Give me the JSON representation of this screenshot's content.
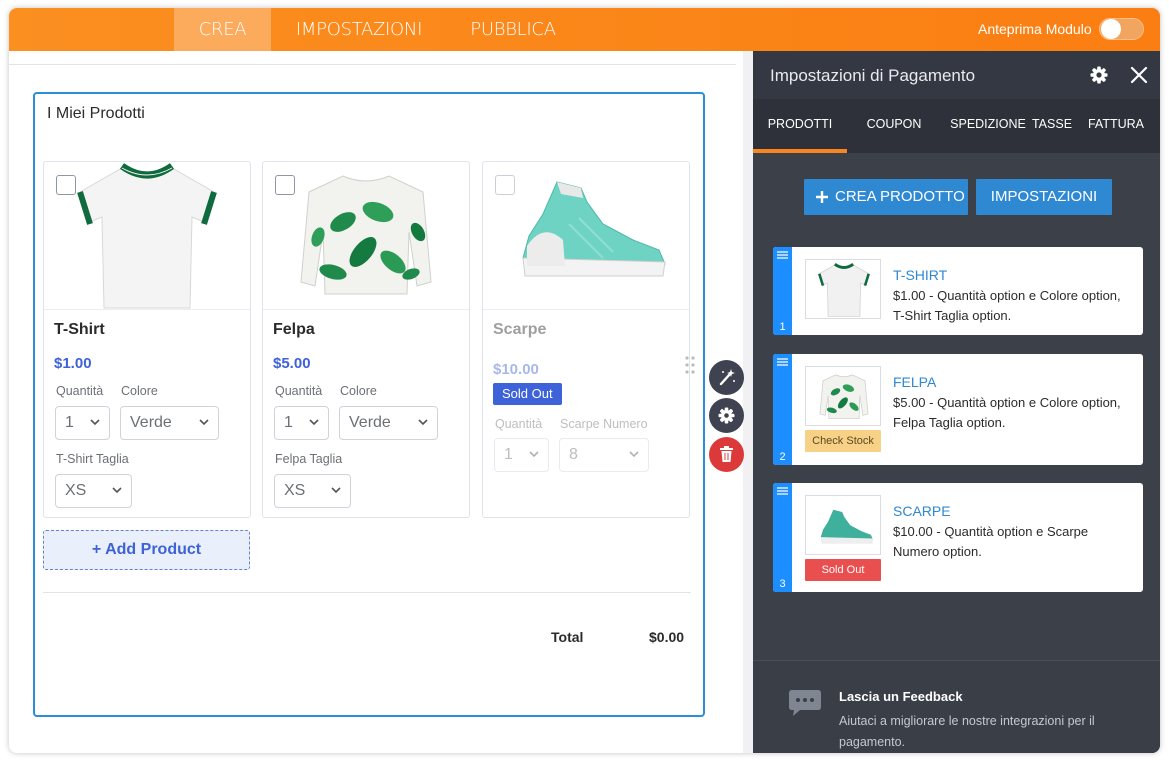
{
  "topbar": {
    "tabs": [
      {
        "label": "CREA",
        "active": true
      },
      {
        "label": "IMPOSTAZIONI",
        "active": false
      },
      {
        "label": "PUBBLICA",
        "active": false
      }
    ],
    "preview_label": "Anteprima Modulo",
    "preview_enabled": false
  },
  "widget": {
    "title": "I Miei Prodotti",
    "products": [
      {
        "name": "T-Shirt",
        "price": "$1.00",
        "fields": [
          {
            "label": "Quantità",
            "value": "1"
          },
          {
            "label": "Colore",
            "value": "Verde"
          },
          {
            "label": "T-Shirt Taglia",
            "value": "XS"
          }
        ]
      },
      {
        "name": "Felpa",
        "price": "$5.00",
        "fields": [
          {
            "label": "Quantità",
            "value": "1"
          },
          {
            "label": "Colore",
            "value": "Verde"
          },
          {
            "label": "Felpa Taglia",
            "value": "XS"
          }
        ]
      },
      {
        "name": "Scarpe",
        "price": "$10.00",
        "badge": "Sold Out",
        "fields": [
          {
            "label": "Quantità",
            "value": "1"
          },
          {
            "label": "Scarpe Numero",
            "value": "8"
          }
        ]
      }
    ],
    "add_product_label": "+ Add Product",
    "total_label": "Total",
    "total_value": "$0.00"
  },
  "panel": {
    "title": "Impostazioni di Pagamento",
    "tabs": [
      {
        "label": "PRODOTTI",
        "active": true
      },
      {
        "label": "COUPON",
        "active": false
      },
      {
        "label": "SPEDIZIONE",
        "active": false
      },
      {
        "label": "TASSE",
        "active": false
      },
      {
        "label": "FATTURA",
        "active": false
      }
    ],
    "create_button": "CREA PRODOTTO",
    "settings_button": "IMPOSTAZIONI",
    "products": [
      {
        "index": "1",
        "title": "T-SHIRT",
        "description": "$1.00 - Quantità option e Colore option, T-Shirt Taglia option.",
        "badge": ""
      },
      {
        "index": "2",
        "title": "FELPA",
        "description": "$5.00 - Quantità option e Colore option, Felpa Taglia option.",
        "badge": "Check Stock"
      },
      {
        "index": "3",
        "title": "SCARPE",
        "description": "$10.00 - Quantità option e Scarpe Numero option.",
        "badge": "Sold Out"
      }
    ],
    "feedback": {
      "title": "Lascia un Feedback",
      "description": "Aiutaci a migliorare le nostre integrazioni per il pagamento."
    }
  },
  "colors": {
    "topbar": "#fb8520",
    "accent_blue": "#2e88d2",
    "price_blue": "#3e62d7",
    "sold_out_red": "#ea4f4f",
    "check_stock_yellow": "#f7d186",
    "panel_bg": "#3c4049"
  },
  "icons": [
    "gear-icon",
    "close-icon",
    "plus-icon",
    "magic-wand-icon",
    "trash-icon",
    "chat-bubble-icon",
    "drag-handle-icon",
    "chevron-down-icon"
  ]
}
